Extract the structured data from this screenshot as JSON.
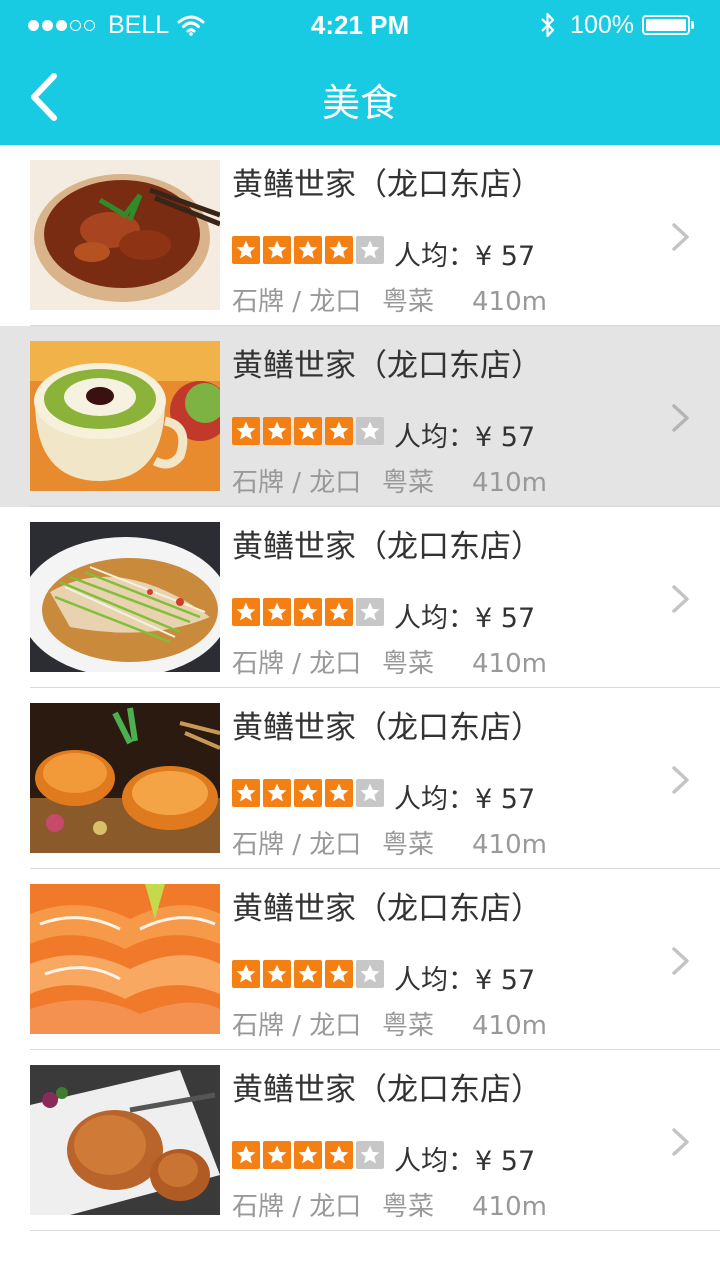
{
  "status_bar": {
    "carrier": "BELL",
    "time": "4:21 PM",
    "battery": "100%"
  },
  "nav": {
    "title": "美食",
    "back_icon": "chevron-left-icon"
  },
  "colors": {
    "accent": "#18cbe2",
    "star_on": "#f47f12",
    "star_off": "#c7c7c7",
    "selected_row": "#e4e4e4"
  },
  "restaurants": [
    {
      "name": "黄鳝世家（龙口东店）",
      "rating": 4,
      "max_rating": 5,
      "price_label": "人均：¥ 57",
      "area": "石牌 / 龙口",
      "cuisine": "粤菜",
      "distance": "410m",
      "selected": false
    },
    {
      "name": "黄鳝世家（龙口东店）",
      "rating": 4,
      "max_rating": 5,
      "price_label": "人均：¥ 57",
      "area": "石牌 / 龙口",
      "cuisine": "粤菜",
      "distance": "410m",
      "selected": true
    },
    {
      "name": "黄鳝世家（龙口东店）",
      "rating": 4,
      "max_rating": 5,
      "price_label": "人均：¥ 57",
      "area": "石牌 / 龙口",
      "cuisine": "粤菜",
      "distance": "410m",
      "selected": false
    },
    {
      "name": "黄鳝世家（龙口东店）",
      "rating": 4,
      "max_rating": 5,
      "price_label": "人均：¥ 57",
      "area": "石牌 / 龙口",
      "cuisine": "粤菜",
      "distance": "410m",
      "selected": false
    },
    {
      "name": "黄鳝世家（龙口东店）",
      "rating": 4,
      "max_rating": 5,
      "price_label": "人均：¥ 57",
      "area": "石牌 / 龙口",
      "cuisine": "粤菜",
      "distance": "410m",
      "selected": false
    },
    {
      "name": "黄鳝世家（龙口东店）",
      "rating": 4,
      "max_rating": 5,
      "price_label": "人均：¥ 57",
      "area": "石牌 / 龙口",
      "cuisine": "粤菜",
      "distance": "410m",
      "selected": false
    }
  ]
}
